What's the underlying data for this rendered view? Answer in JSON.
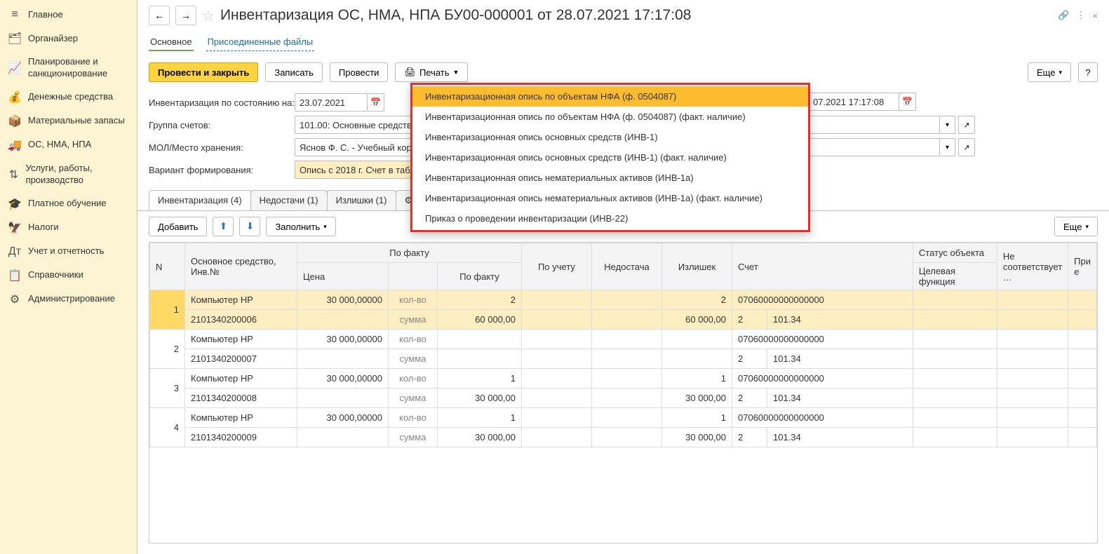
{
  "sidebar": {
    "items": [
      {
        "icon": "≡",
        "label": "Главное"
      },
      {
        "icon": "🗂",
        "label": "Органайзер"
      },
      {
        "icon": "📈",
        "label": "Планирование и санкционирование"
      },
      {
        "icon": "💰",
        "label": "Денежные средства"
      },
      {
        "icon": "📦",
        "label": "Материальные запасы"
      },
      {
        "icon": "🚚",
        "label": "ОС, НМА, НПА"
      },
      {
        "icon": "⇅",
        "label": "Услуги, работы, производство"
      },
      {
        "icon": "🎓",
        "label": "Платное обучение"
      },
      {
        "icon": "🦅",
        "label": "Налоги"
      },
      {
        "icon": "Дт",
        "label": "Учет и отчетность"
      },
      {
        "icon": "📋",
        "label": "Справочники"
      },
      {
        "icon": "⚙",
        "label": "Администрирование"
      }
    ]
  },
  "header": {
    "title": "Инвентаризация ОС, НМА, НПА БУ00-000001 от 28.07.2021 17:17:08"
  },
  "doc_tabs": {
    "main": "Основное",
    "files": "Присоединенные файлы"
  },
  "toolbar": {
    "post_close": "Провести и закрыть",
    "save": "Записать",
    "post": "Провести",
    "print": "Печать",
    "more": "Еще"
  },
  "form": {
    "asof_label": "Инвентаризация по состоянию на:",
    "asof_value": "23.07.2021",
    "date_value": "07.2021 17:17:08",
    "group_label": "Группа счетов:",
    "group_value": "101.00: Основные средства",
    "mol_label": "МОЛ/Место хранения:",
    "mol_value": "Яснов Ф. С. - Учебный корп",
    "variant_label": "Вариант формирования:",
    "variant_value": "Опись с 2018 г. Счет в табл"
  },
  "subtabs": {
    "inv": "Инвентаризация (4)",
    "short": "Недостачи (1)",
    "over": "Излишки (1)",
    "settings": "Н…"
  },
  "tbl_toolbar": {
    "add": "Добавить",
    "fill": "Заполнить",
    "more": "Еще"
  },
  "columns": {
    "n": "N",
    "asset": "Основное средство, Инв.№",
    "price": "Цена",
    "fact_group": "По факту",
    "fact": "По факту",
    "acct_group": "По учету",
    "short": "Недостача",
    "over": "Излишек",
    "account": "Счет",
    "status": "Статус объекта",
    "target": "Целевая функция",
    "mismatch": "Не соответствует …",
    "note": "При е"
  },
  "row_labels": {
    "qty": "кол-во",
    "sum": "сумма"
  },
  "rows": [
    {
      "n": "1",
      "name": "Компьютер HP",
      "inv": "2101340200006",
      "price": "30 000,00000",
      "fact_qty": "2",
      "fact_sum": "60 000,00",
      "over_qty": "2",
      "over_sum": "60 000,00",
      "code": "07060000000000000",
      "acc_n": "2",
      "acc": "101.34",
      "sel": true
    },
    {
      "n": "2",
      "name": "Компьютер HP",
      "inv": "2101340200007",
      "price": "30 000,00000",
      "fact_qty": "",
      "fact_sum": "",
      "over_qty": "",
      "over_sum": "",
      "code": "07060000000000000",
      "acc_n": "2",
      "acc": "101.34",
      "sel": false
    },
    {
      "n": "3",
      "name": "Компьютер HP",
      "inv": "2101340200008",
      "price": "30 000,00000",
      "fact_qty": "1",
      "fact_sum": "30 000,00",
      "over_qty": "1",
      "over_sum": "30 000,00",
      "code": "07060000000000000",
      "acc_n": "2",
      "acc": "101.34",
      "sel": false
    },
    {
      "n": "4",
      "name": "Компьютер HP",
      "inv": "2101340200009",
      "price": "30 000,00000",
      "fact_qty": "1",
      "fact_sum": "30 000,00",
      "over_qty": "1",
      "over_sum": "30 000,00",
      "code": "07060000000000000",
      "acc_n": "2",
      "acc": "101.34",
      "sel": false
    }
  ],
  "print_menu": [
    "Инвентаризационная опись по объектам НФА (ф. 0504087)",
    "Инвентаризационная опись по объектам НФА (ф. 0504087) (факт. наличие)",
    "Инвентаризационная опись основных средств (ИНВ-1)",
    "Инвентаризационная опись основных средств (ИНВ-1) (факт. наличие)",
    "Инвентаризационная опись нематериальных активов (ИНВ-1а)",
    "Инвентаризационная опись нематериальных активов (ИНВ-1а) (факт. наличие)",
    "Приказ о проведении инвентаризации (ИНВ-22)"
  ]
}
